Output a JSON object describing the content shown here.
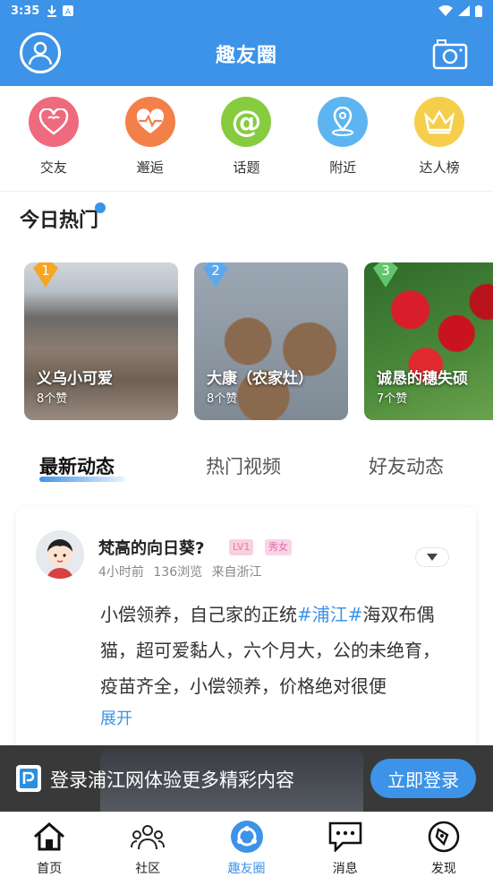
{
  "status_bar": {
    "time": "3:35"
  },
  "header": {
    "title": "趣友圈"
  },
  "categories": [
    {
      "label": "交友",
      "icon": "heart-icon",
      "color": "#ee6a7c"
    },
    {
      "label": "邂逅",
      "icon": "heartbeat-icon",
      "color": "#f28048"
    },
    {
      "label": "话题",
      "icon": "at-icon",
      "color": "#86cc3e"
    },
    {
      "label": "附近",
      "icon": "location-icon",
      "color": "#5cb5f0"
    },
    {
      "label": "达人榜",
      "icon": "crown-icon",
      "color": "#f5cf4c"
    }
  ],
  "hot_section": {
    "title": "今日热门",
    "items": [
      {
        "rank": "1",
        "name": "义乌小可爱",
        "likes": "8个赞",
        "rank_color": "#f5a623"
      },
      {
        "rank": "2",
        "name": "大康（农家灶）",
        "likes": "8个赞",
        "rank_color": "#5aa8f0"
      },
      {
        "rank": "3",
        "name": "诚恳的穗失硕",
        "likes": "7个赞",
        "rank_color": "#63c56b"
      }
    ]
  },
  "tabs": [
    {
      "label": "最新动态",
      "active": true
    },
    {
      "label": "热门视频",
      "active": false
    },
    {
      "label": "好友动态",
      "active": false
    }
  ],
  "post": {
    "author": "梵高的向日葵?",
    "level": "LV1",
    "gender_badge": "秀女",
    "time": "4小时前",
    "views": "136浏览",
    "location": "来自浙江",
    "text_before": "小偿领养，自己家的正统",
    "tag": "#浦江#",
    "text_after": "海双布偶猫，超可爱黏人，六个月大，公的未绝育，疫苗齐全，小偿领养，价格绝对很便",
    "expand": "展开"
  },
  "login_banner": {
    "text": "登录浦江网体验更多精彩内容",
    "button": "立即登录"
  },
  "bottom_nav": [
    {
      "label": "首页",
      "icon": "home-icon",
      "active": false
    },
    {
      "label": "社区",
      "icon": "community-icon",
      "active": false
    },
    {
      "label": "趣友圈",
      "icon": "circle-icon",
      "active": true
    },
    {
      "label": "消息",
      "icon": "message-icon",
      "active": false
    },
    {
      "label": "发现",
      "icon": "compass-icon",
      "active": false
    }
  ],
  "colors": {
    "primary": "#3c93e8"
  }
}
